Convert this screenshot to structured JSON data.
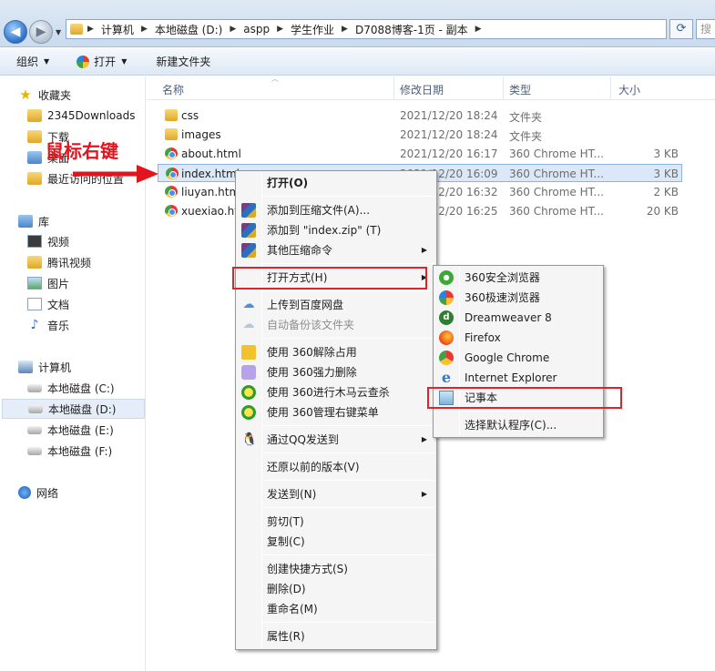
{
  "address": {
    "crumbs": [
      "计算机",
      "本地磁盘 (D:)",
      "aspp",
      "学生作业",
      "D7088博客-1页 - 副本"
    ],
    "search_placeholder": "搜"
  },
  "toolbar": {
    "organize": "组织",
    "open": "打开",
    "new_folder": "新建文件夹"
  },
  "nav": {
    "favorites": "收藏夹",
    "fav_items": [
      "2345Downloads",
      "下载",
      "桌面",
      "最近访问的位置"
    ],
    "libraries": "库",
    "lib_items": [
      "视频",
      "腾讯视频",
      "图片",
      "文档",
      "音乐"
    ],
    "computer": "计算机",
    "drives": [
      "本地磁盘 (C:)",
      "本地磁盘 (D:)",
      "本地磁盘 (E:)",
      "本地磁盘 (F:)"
    ],
    "network": "网络"
  },
  "columns": [
    "名称",
    "修改日期",
    "类型",
    "大小"
  ],
  "files": [
    {
      "name": "css",
      "date": "2021/12/20 18:24",
      "type": "文件夹",
      "size": ""
    },
    {
      "name": "images",
      "date": "2021/12/20 18:24",
      "type": "文件夹",
      "size": ""
    },
    {
      "name": "about.html",
      "date": "2021/12/20 16:17",
      "type": "360 Chrome HT...",
      "size": "3 KB"
    },
    {
      "name": "index.html",
      "date": "2021/12/20 16:09",
      "type": "360 Chrome HT...",
      "size": "3 KB"
    },
    {
      "name": "liuyan.html",
      "date": "2021/12/20 16:32",
      "type": "360 Chrome HT...",
      "size": "2 KB"
    },
    {
      "name": "xuexiao.html",
      "date": "2021/12/20 16:25",
      "type": "360 Chrome HT...",
      "size": "20 KB"
    }
  ],
  "annotation": "鼠标右键",
  "context_menu": {
    "open": "打开(O)",
    "add_archive": "添加到压缩文件(A)...",
    "add_zip": "添加到 \"index.zip\" (T)",
    "other_compress": "其他压缩命令",
    "open_with": "打开方式(H)",
    "upload_baidu": "上传到百度网盘",
    "auto_backup": "自动备份该文件夹",
    "unlock_360": "使用 360解除占用",
    "force_delete_360": "使用 360强力删除",
    "trojan_scan_360": "使用 360进行木马云查杀",
    "manage_menu_360": "使用 360管理右键菜单",
    "send_qq": "通过QQ发送到",
    "restore_prev": "还原以前的版本(V)",
    "send_to": "发送到(N)",
    "cut": "剪切(T)",
    "copy": "复制(C)",
    "create_shortcut": "创建快捷方式(S)",
    "delete": "删除(D)",
    "rename": "重命名(M)",
    "properties": "属性(R)"
  },
  "open_with_menu": {
    "items": [
      "360安全浏览器",
      "360极速浏览器",
      "Dreamweaver 8",
      "Firefox",
      "Google Chrome",
      "Internet Explorer",
      "记事本"
    ],
    "choose_default": "选择默认程序(C)..."
  },
  "colors": {
    "annotation_red": "#e2141d",
    "highlight_box": "#d8262e",
    "selection": "#dbe8f8"
  }
}
